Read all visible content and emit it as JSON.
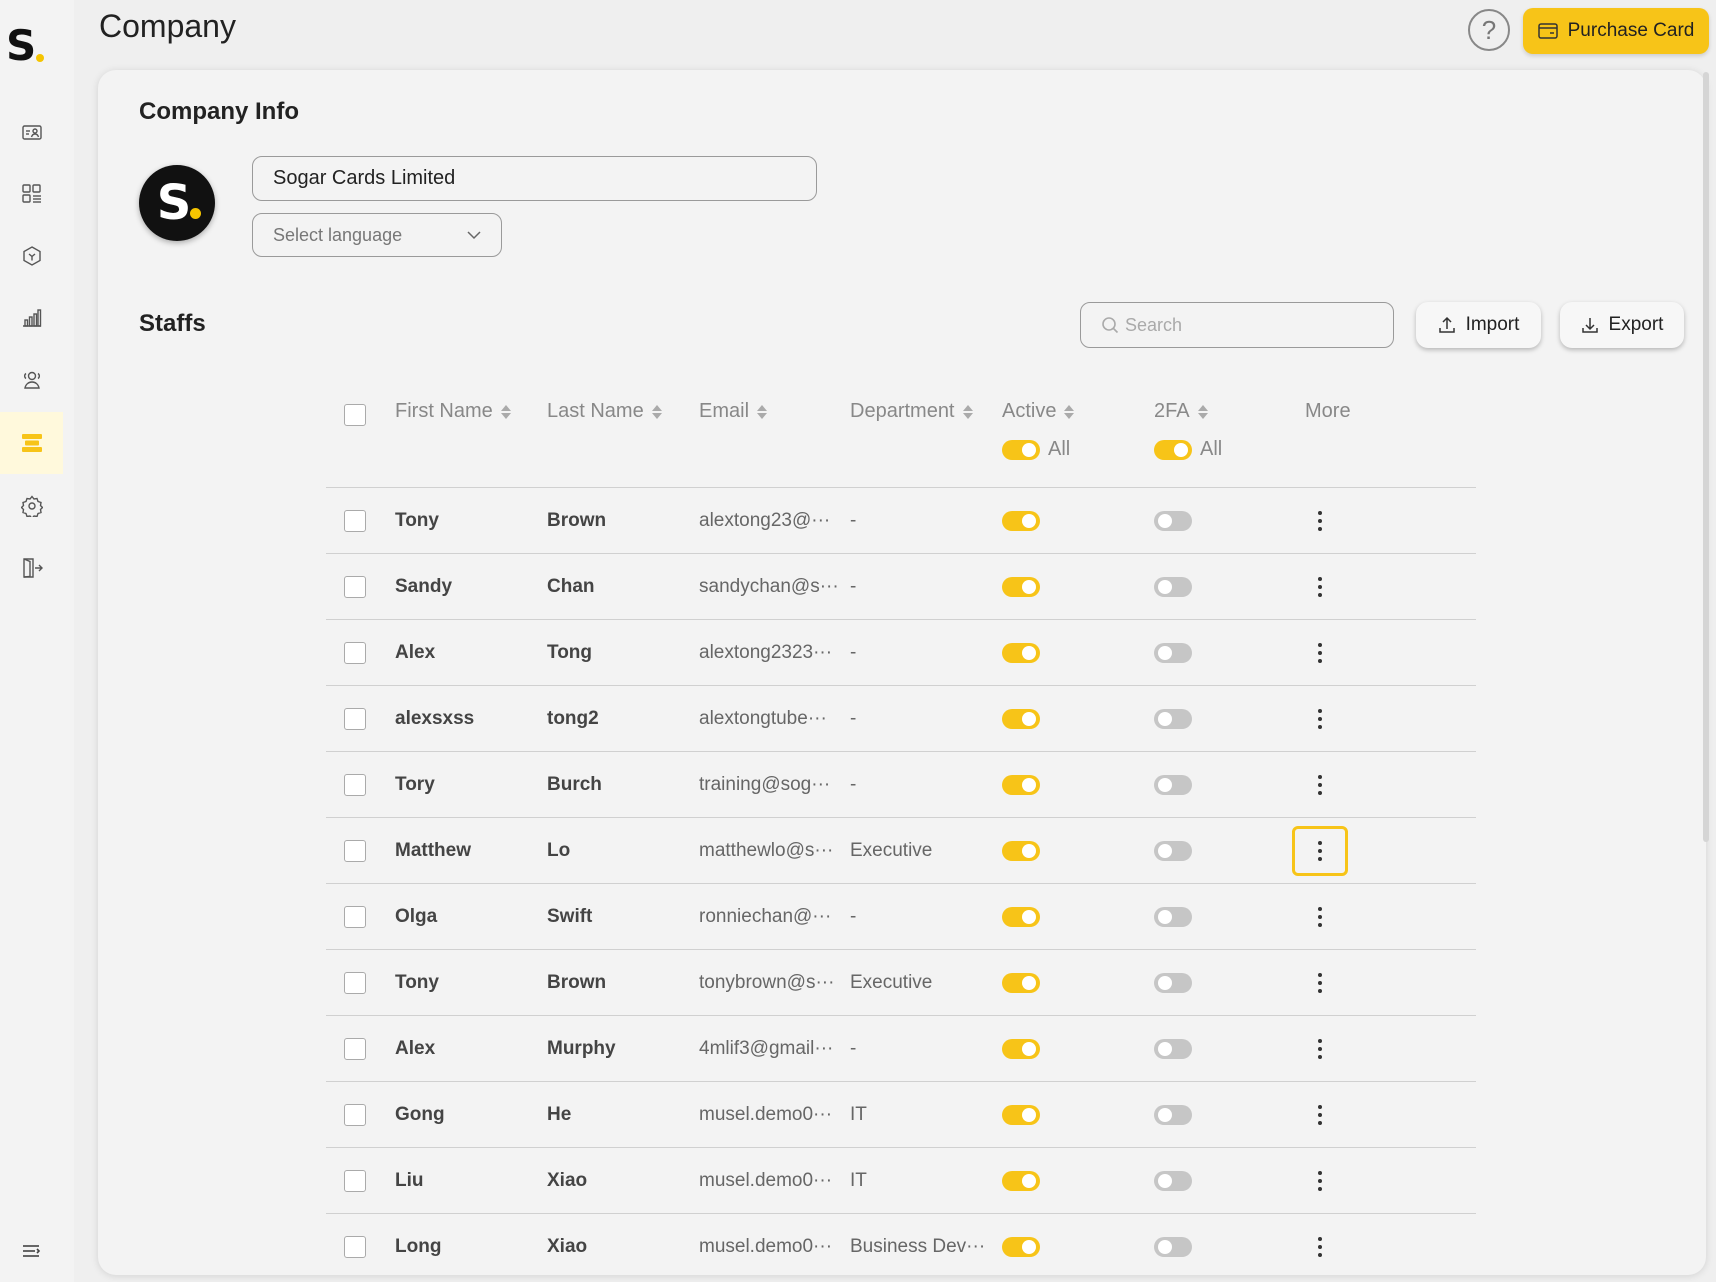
{
  "header": {
    "title": "Company",
    "help_icon": "?",
    "purchase_label": "Purchase Card"
  },
  "sidebar": {
    "logo_text": "S",
    "items": [
      {
        "name": "profile-card-icon"
      },
      {
        "name": "dashboard-grid-icon"
      },
      {
        "name": "product-cube-icon"
      },
      {
        "name": "bar-chart-icon"
      },
      {
        "name": "users-icon"
      },
      {
        "name": "company-icon",
        "active": true
      },
      {
        "name": "gear-icon"
      },
      {
        "name": "logout-icon"
      }
    ]
  },
  "company": {
    "section_title": "Company Info",
    "logo_text": "S",
    "name_value": "Sogar Cards Limited",
    "language_placeholder": "Select language"
  },
  "staffs": {
    "section_title": "Staffs",
    "search_placeholder": "Search",
    "import_label": "Import",
    "export_label": "Export",
    "columns": {
      "first_name": "First Name",
      "last_name": "Last Name",
      "email": "Email",
      "department": "Department",
      "active": "Active",
      "twofa": "2FA",
      "more": "More"
    },
    "filter_all": "All",
    "rows": [
      {
        "first": "Tony",
        "last": "Brown",
        "email": "alextong23@···",
        "dept": "-",
        "active": true,
        "twofa": false
      },
      {
        "first": "Sandy",
        "last": "Chan",
        "email": "sandychan@s···",
        "dept": "-",
        "active": true,
        "twofa": false
      },
      {
        "first": "Alex",
        "last": "Tong",
        "email": "alextong2323···",
        "dept": "-",
        "active": true,
        "twofa": false
      },
      {
        "first": "alexsxss",
        "last": "tong2",
        "email": "alextongtube···",
        "dept": "-",
        "active": true,
        "twofa": false
      },
      {
        "first": "Tory",
        "last": "Burch",
        "email": "training@sog···",
        "dept": "-",
        "active": true,
        "twofa": false
      },
      {
        "first": "Matthew",
        "last": "Lo",
        "email": "matthewlo@s···",
        "dept": "Executive",
        "active": true,
        "twofa": false,
        "focused": true
      },
      {
        "first": "Olga",
        "last": "Swift",
        "email": "ronniechan@···",
        "dept": "-",
        "active": true,
        "twofa": false
      },
      {
        "first": "Tony",
        "last": "Brown",
        "email": "tonybrown@s···",
        "dept": "Executive",
        "active": true,
        "twofa": false
      },
      {
        "first": "Alex",
        "last": "Murphy",
        "email": "4mlif3@gmail···",
        "dept": "-",
        "active": true,
        "twofa": false
      },
      {
        "first": "Gong",
        "last": "He",
        "email": "musel.demo0···",
        "dept": "IT",
        "active": true,
        "twofa": false
      },
      {
        "first": "Liu",
        "last": "Xiao",
        "email": "musel.demo0···",
        "dept": "IT",
        "active": true,
        "twofa": false
      },
      {
        "first": "Long",
        "last": "Xiao",
        "email": "musel.demo0···",
        "dept": "Business Dev···",
        "active": true,
        "twofa": false
      }
    ]
  },
  "colors": {
    "accent": "#f7c418",
    "toggle_off": "#c6c6c6"
  }
}
